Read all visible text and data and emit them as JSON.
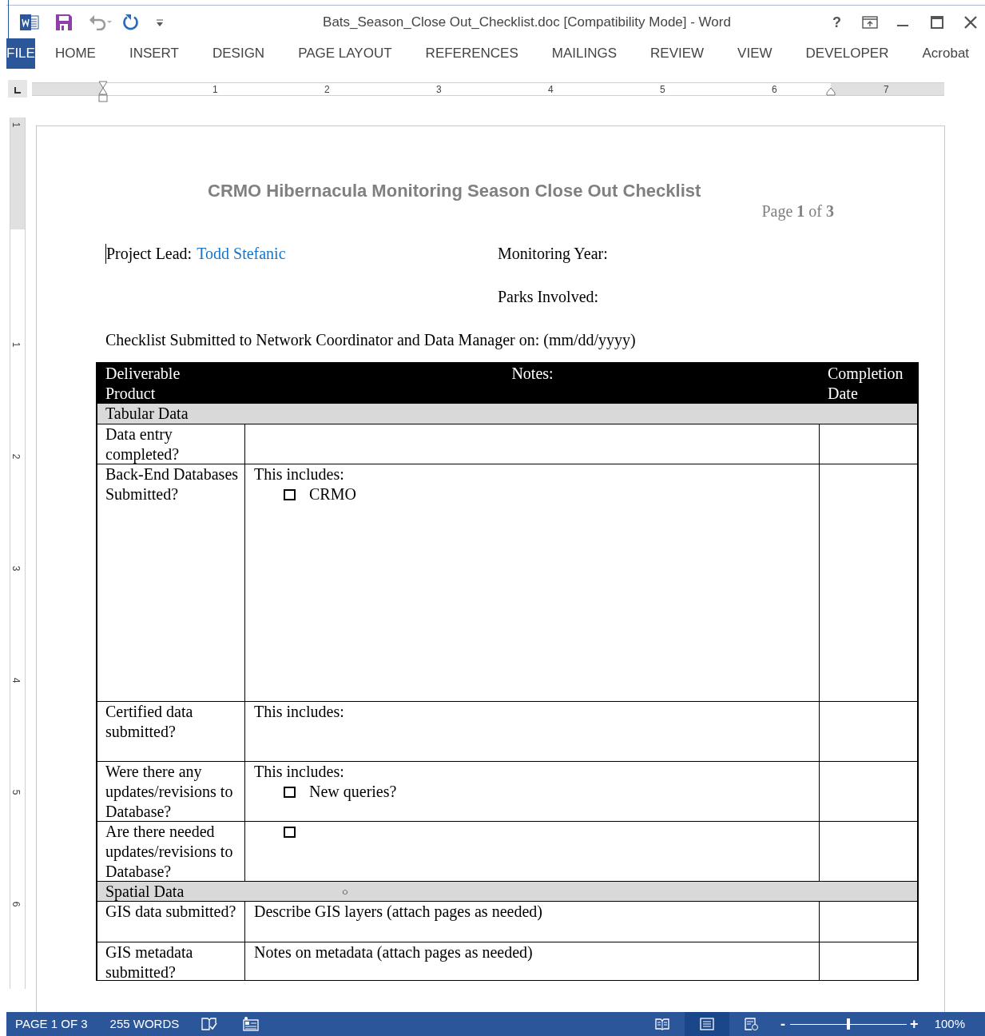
{
  "window": {
    "title": "Bats_Season_Close Out_Checklist.doc [Compatibility Mode] - Word",
    "help": "?"
  },
  "ribbon_tabs": [
    {
      "label": "FILE",
      "selected": true
    },
    {
      "label": "HOME",
      "selected": false
    },
    {
      "label": "INSERT",
      "selected": false
    },
    {
      "label": "DESIGN",
      "selected": false
    },
    {
      "label": "PAGE LAYOUT",
      "selected": false
    },
    {
      "label": "REFERENCES",
      "selected": false
    },
    {
      "label": "MAILINGS",
      "selected": false
    },
    {
      "label": "REVIEW",
      "selected": false
    },
    {
      "label": "VIEW",
      "selected": false
    },
    {
      "label": "DEVELOPER",
      "selected": false
    },
    {
      "label": "Acrobat",
      "selected": false
    }
  ],
  "ruler": {
    "numbers": [
      "1",
      "2",
      "3",
      "4",
      "5",
      "6",
      "7"
    ]
  },
  "vertical_ruler": {
    "numbers": [
      "1",
      "1",
      "2",
      "3",
      "4",
      "5",
      "6"
    ]
  },
  "document": {
    "title": "CRMO Hibernacula Monitoring Season Close Out Checklist",
    "page_label": "Page **1** of **3**",
    "project_lead_label": "Project Lead:",
    "project_lead": "Todd Stefanic",
    "monitoring_year": "Monitoring Year:",
    "parks_involved": "Parks Involved:",
    "submitted_line": "Checklist Submitted to Network Coordinator and Data Manager on: (mm/dd/yyyy)",
    "table": {
      "columns": [
        "Deliverable Product",
        "Notes:",
        "Completion Date"
      ],
      "rows": [
        {
          "kind": "section",
          "label": "Tabular Data"
        },
        {
          "kind": "item",
          "label": "Data entry completed?",
          "notes": []
        },
        {
          "kind": "item",
          "label": "Back-End Databases Submitted?",
          "notes": [
            {
              "kind": "text",
              "text": "This includes:"
            },
            {
              "kind": "checkbox",
              "text": "CRMO",
              "checked": false
            }
          ]
        },
        {
          "kind": "item",
          "label": "Certified data submitted?",
          "notes": [
            {
              "kind": "text",
              "text": "This includes:"
            }
          ]
        },
        {
          "kind": "item",
          "label": "Were there any updates/revisions to Database?",
          "notes": [
            {
              "kind": "text",
              "text": "This includes:"
            },
            {
              "kind": "checkbox",
              "text": "New queries?",
              "checked": false
            }
          ]
        },
        {
          "kind": "item",
          "label": "Are there needed updates/revisions to Database?",
          "notes": [
            {
              "kind": "checkbox",
              "checked": false
            }
          ]
        },
        {
          "kind": "section",
          "label": "Spatial Data",
          "mark": "○"
        },
        {
          "kind": "item",
          "label": "GIS data submitted?",
          "notes": [
            {
              "kind": "text",
              "text": "Describe GIS layers (attach pages as needed)"
            }
          ]
        },
        {
          "kind": "item",
          "label": "GIS metadata submitted?",
          "notes": [
            {
              "kind": "text",
              "text": "Notes on metadata (attach pages as needed)"
            }
          ]
        }
      ]
    }
  },
  "status_bar": {
    "page": "PAGE 1 OF 3",
    "words": "255 WORDS",
    "views": [
      {
        "kind": "read",
        "selected": false
      },
      {
        "kind": "print",
        "selected": true
      },
      {
        "kind": "web",
        "selected": false
      }
    ],
    "zoom": {
      "minus": "-",
      "plus": "+",
      "level": 0.5,
      "reading": "100%"
    }
  }
}
